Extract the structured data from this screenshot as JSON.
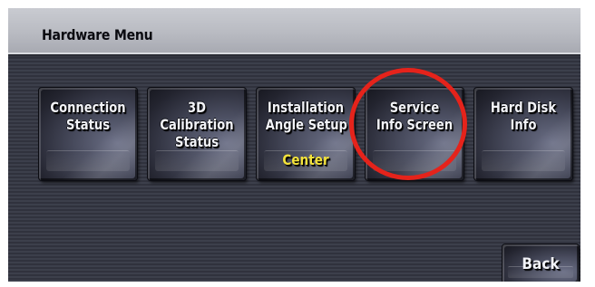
{
  "header": {
    "title": "Hardware Menu"
  },
  "buttons": [
    {
      "label": "Connection\nStatus"
    },
    {
      "label": "3D\nCalibration\nStatus"
    },
    {
      "label": "Installation\nAngle Setup",
      "value": "Center"
    },
    {
      "label": "Service\nInfo Screen"
    },
    {
      "label": "Hard Disk\nInfo"
    }
  ],
  "footer": {
    "back_label": "Back"
  },
  "colors": {
    "highlight_circle": "#e5231b",
    "value_text": "#f3e23b"
  }
}
